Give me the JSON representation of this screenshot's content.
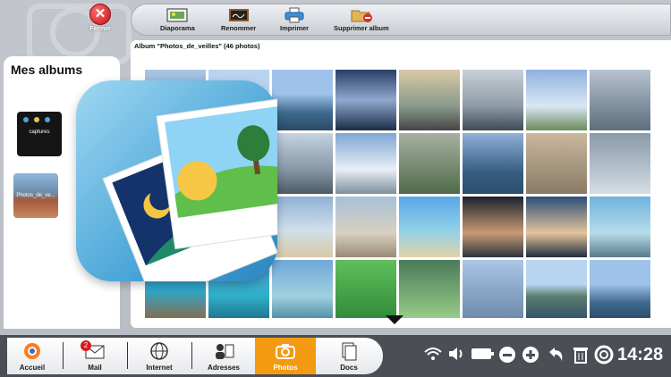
{
  "close": {
    "label": "Fermer"
  },
  "toolbar": {
    "slideshow": "Diaporama",
    "rename": "Renommer",
    "print": "Imprimer",
    "delete_album": "Supprimer album"
  },
  "albums": {
    "title": "Mes albums",
    "items": [
      {
        "name": "captures"
      },
      {
        "name": "Photos_de_ve..."
      }
    ]
  },
  "grid": {
    "title": "Album \"Photos_de_veilles\" (46 photos)"
  },
  "dock": {
    "items": [
      {
        "label": "Accueil"
      },
      {
        "label": "Mail",
        "badge": "2"
      },
      {
        "label": "Internet"
      },
      {
        "label": "Adresses"
      },
      {
        "label": "Photos"
      },
      {
        "label": "Docs"
      }
    ],
    "active": "Photos"
  },
  "status": {
    "time": "14:28"
  },
  "colors": {
    "accent": "#f39a10",
    "dock": "#4b4f55",
    "close_red": "#c0161b"
  }
}
